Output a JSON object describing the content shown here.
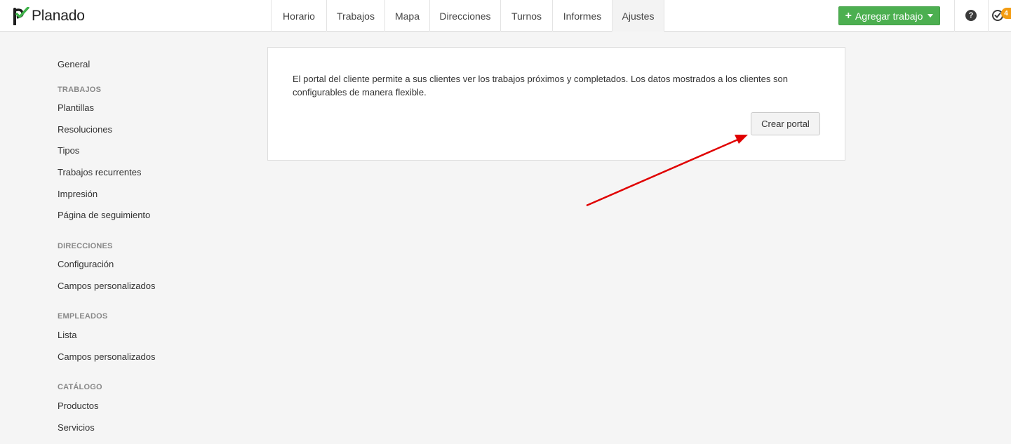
{
  "header": {
    "logo_text": "Planado",
    "tabs": [
      {
        "label": "Horario"
      },
      {
        "label": "Trabajos"
      },
      {
        "label": "Mapa"
      },
      {
        "label": "Direcciones"
      },
      {
        "label": "Turnos"
      },
      {
        "label": "Informes"
      },
      {
        "label": "Ajustes",
        "active": true
      }
    ],
    "add_button_label": "Agregar trabajo",
    "help_icon_glyph": "?",
    "notifications_count": "4",
    "icons": [
      "planado-logo-icon",
      "plus-icon",
      "caret-down-icon",
      "help-icon",
      "clock-check-icon"
    ]
  },
  "sidebar": {
    "general": "General",
    "sections": [
      {
        "title": "TRABAJOS",
        "items": [
          "Plantillas",
          "Resoluciones",
          "Tipos",
          "Trabajos recurrentes",
          "Impresión",
          "Página de seguimiento"
        ]
      },
      {
        "title": "DIRECCIONES",
        "items": [
          "Configuración",
          "Campos personalizados"
        ]
      },
      {
        "title": "EMPLEADOS",
        "items": [
          "Lista",
          "Campos personalizados"
        ]
      },
      {
        "title": "CATÁLOGO",
        "items": [
          "Productos",
          "Servicios"
        ]
      }
    ]
  },
  "main": {
    "description": "El portal del cliente permite a sus clientes ver los trabajos próximos y completados. Los datos mostrados a los clientes son configurables de manera flexible.",
    "create_button_label": "Crear portal"
  },
  "colors": {
    "brand_green": "#4caf50",
    "logo_green": "#3fb24a",
    "badge_orange": "#f39c12",
    "annotation_arrow": "#e00000"
  }
}
